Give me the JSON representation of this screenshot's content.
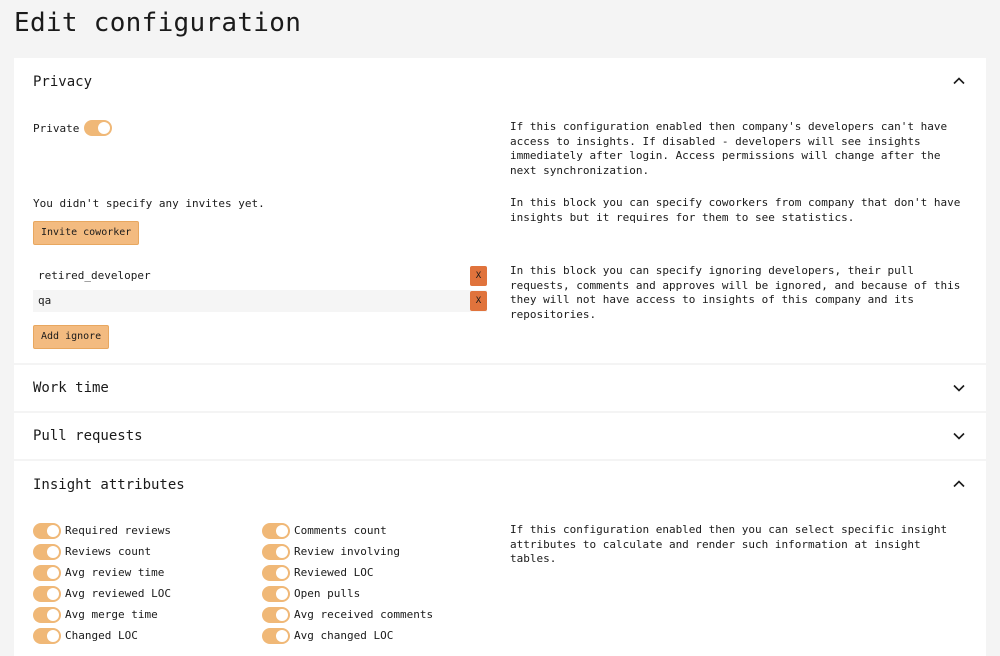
{
  "page": {
    "title": "Edit configuration"
  },
  "privacy": {
    "title": "Privacy",
    "chevron_icon": "chevron-up-icon",
    "private_label": "Private",
    "private_on": true,
    "private_desc": "If this configuration enabled then company's developers can't have access to insights. If disabled - developers will see insights immediately after login. Access permissions will change after the next synchronization.",
    "invites_empty": "You didn't specify any invites yet.",
    "invite_button": "Invite coworker",
    "invites_desc": "In this block you can specify coworkers from company that don't have insights but it requires for them to see statistics.",
    "ignores": [
      {
        "name": "retired_developer",
        "remove": "X"
      },
      {
        "name": "qa",
        "remove": "X"
      }
    ],
    "add_ignore_button": "Add ignore",
    "ignores_desc": "In this block you can specify ignoring developers, their pull requests, comments and approves will be ignored, and because of this they will not have access to insights of this company and its repositories."
  },
  "work_time": {
    "title": "Work time",
    "chevron_icon": "chevron-down-icon"
  },
  "pull_requests": {
    "title": "Pull requests",
    "chevron_icon": "chevron-down-icon"
  },
  "insight_attributes": {
    "title": "Insight attributes",
    "chevron_icon": "chevron-up-icon",
    "desc": "If this configuration enabled then you can select specific insight attributes to calculate and render such information at insight tables.",
    "left": [
      {
        "label": "Required reviews",
        "on": true
      },
      {
        "label": "Reviews count",
        "on": true
      },
      {
        "label": "Avg review time",
        "on": true
      },
      {
        "label": "Avg reviewed LOC",
        "on": true
      },
      {
        "label": "Avg merge time",
        "on": true
      },
      {
        "label": "Changed LOC",
        "on": true
      }
    ],
    "right": [
      {
        "label": "Comments count",
        "on": true
      },
      {
        "label": "Review involving",
        "on": true
      },
      {
        "label": "Reviewed LOC",
        "on": true
      },
      {
        "label": "Open pulls",
        "on": true
      },
      {
        "label": "Avg received comments",
        "on": true
      },
      {
        "label": "Avg changed LOC",
        "on": true
      }
    ]
  },
  "colors": {
    "toggle_on": "#f0b877",
    "button": "#f3bb80",
    "remove": "#e0733c"
  }
}
